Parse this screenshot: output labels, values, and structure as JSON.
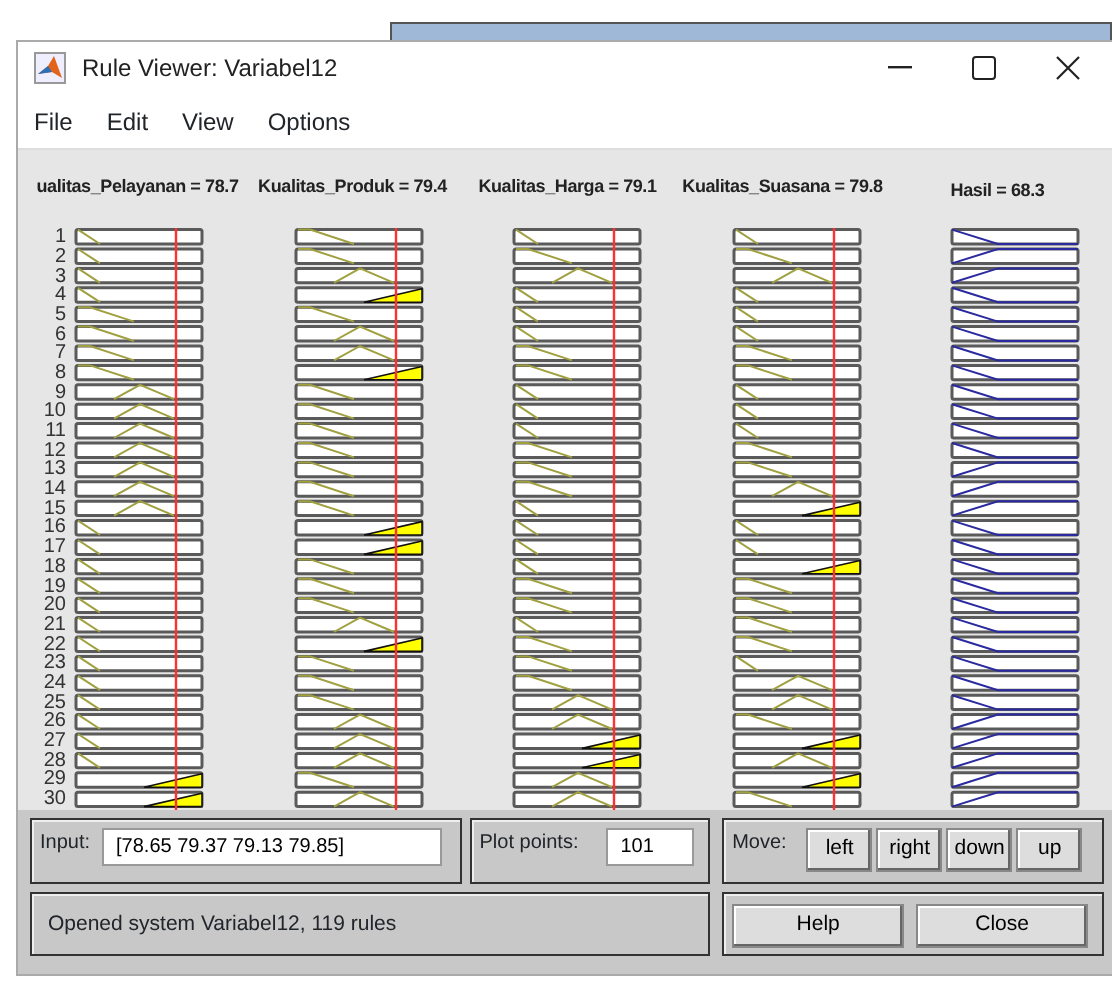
{
  "window": {
    "title": "Rule Viewer: Variabel12"
  },
  "menu": [
    "File",
    "Edit",
    "View",
    "Options"
  ],
  "rule_numbers": [
    "1",
    "2",
    "3",
    "4",
    "5",
    "6",
    "7",
    "8",
    "9",
    "10",
    "11",
    "12",
    "13",
    "14",
    "15",
    "16",
    "17",
    "18",
    "19",
    "20",
    "21",
    "22",
    "23",
    "24",
    "25",
    "26",
    "27",
    "28",
    "29",
    "30"
  ],
  "inputs": [
    {
      "heading": "ualitas_Pelayanan = 78.7",
      "cells": [
        {
          "kind": "low"
        },
        {
          "kind": "low"
        },
        {
          "kind": "low"
        },
        {
          "kind": "low"
        },
        {
          "kind": "fall"
        },
        {
          "kind": "fall"
        },
        {
          "kind": "fall"
        },
        {
          "kind": "fall"
        },
        {
          "kind": "mid"
        },
        {
          "kind": "mid"
        },
        {
          "kind": "mid"
        },
        {
          "kind": "mid"
        },
        {
          "kind": "mid"
        },
        {
          "kind": "mid"
        },
        {
          "kind": "mid"
        },
        {
          "kind": "low"
        },
        {
          "kind": "low"
        },
        {
          "kind": "low"
        },
        {
          "kind": "low"
        },
        {
          "kind": "low"
        },
        {
          "kind": "low"
        },
        {
          "kind": "low"
        },
        {
          "kind": "low"
        },
        {
          "kind": "low"
        },
        {
          "kind": "low"
        },
        {
          "kind": "low"
        },
        {
          "kind": "low"
        },
        {
          "kind": "low"
        },
        {
          "kind": "fired"
        },
        {
          "kind": "fired"
        }
      ]
    },
    {
      "heading": "Kualitas_Produk = 79.4",
      "cells": [
        {
          "kind": "fall"
        },
        {
          "kind": "fall"
        },
        {
          "kind": "mid"
        },
        {
          "kind": "fired"
        },
        {
          "kind": "fall"
        },
        {
          "kind": "mid"
        },
        {
          "kind": "mid"
        },
        {
          "kind": "fired"
        },
        {
          "kind": "fall"
        },
        {
          "kind": "fall"
        },
        {
          "kind": "fall"
        },
        {
          "kind": "fall"
        },
        {
          "kind": "fall"
        },
        {
          "kind": "fall"
        },
        {
          "kind": "fall"
        },
        {
          "kind": "fired"
        },
        {
          "kind": "fired"
        },
        {
          "kind": "fall"
        },
        {
          "kind": "fall"
        },
        {
          "kind": "fall"
        },
        {
          "kind": "mid"
        },
        {
          "kind": "fired"
        },
        {
          "kind": "fall"
        },
        {
          "kind": "fall"
        },
        {
          "kind": "fall"
        },
        {
          "kind": "mid"
        },
        {
          "kind": "mid"
        },
        {
          "kind": "mid"
        },
        {
          "kind": "fall"
        },
        {
          "kind": "mid"
        }
      ]
    },
    {
      "heading": "Kualitas_Harga = 79.1",
      "cells": [
        {
          "kind": "low"
        },
        {
          "kind": "fall"
        },
        {
          "kind": "mid"
        },
        {
          "kind": "low"
        },
        {
          "kind": "low"
        },
        {
          "kind": "low"
        },
        {
          "kind": "fall"
        },
        {
          "kind": "fall"
        },
        {
          "kind": "low"
        },
        {
          "kind": "low"
        },
        {
          "kind": "low"
        },
        {
          "kind": "fall"
        },
        {
          "kind": "fall"
        },
        {
          "kind": "fall"
        },
        {
          "kind": "low"
        },
        {
          "kind": "low"
        },
        {
          "kind": "low"
        },
        {
          "kind": "low"
        },
        {
          "kind": "fall"
        },
        {
          "kind": "fall"
        },
        {
          "kind": "low"
        },
        {
          "kind": "fall"
        },
        {
          "kind": "fall"
        },
        {
          "kind": "fall"
        },
        {
          "kind": "mid"
        },
        {
          "kind": "mid"
        },
        {
          "kind": "fired"
        },
        {
          "kind": "fired"
        },
        {
          "kind": "mid"
        },
        {
          "kind": "mid"
        }
      ]
    },
    {
      "heading": "Kualitas_Suasana = 79.8",
      "cells": [
        {
          "kind": "low"
        },
        {
          "kind": "fall"
        },
        {
          "kind": "mid"
        },
        {
          "kind": "low"
        },
        {
          "kind": "low"
        },
        {
          "kind": "low"
        },
        {
          "kind": "fall"
        },
        {
          "kind": "fall"
        },
        {
          "kind": "low"
        },
        {
          "kind": "low"
        },
        {
          "kind": "low"
        },
        {
          "kind": "fall"
        },
        {
          "kind": "fall"
        },
        {
          "kind": "mid"
        },
        {
          "kind": "fired"
        },
        {
          "kind": "low"
        },
        {
          "kind": "low"
        },
        {
          "kind": "fired"
        },
        {
          "kind": "fall"
        },
        {
          "kind": "fall"
        },
        {
          "kind": "fall"
        },
        {
          "kind": "fall"
        },
        {
          "kind": "low"
        },
        {
          "kind": "mid"
        },
        {
          "kind": "mid"
        },
        {
          "kind": "fall"
        },
        {
          "kind": "fired"
        },
        {
          "kind": "mid"
        },
        {
          "kind": "fired"
        },
        {
          "kind": "fall"
        }
      ]
    }
  ],
  "output": {
    "heading": "Hasil = 68.3",
    "cells": [
      {
        "kind": "fall"
      },
      {
        "kind": "rise"
      },
      {
        "kind": "rise"
      },
      {
        "kind": "fall"
      },
      {
        "kind": "fall"
      },
      {
        "kind": "fall"
      },
      {
        "kind": "fall"
      },
      {
        "kind": "fall"
      },
      {
        "kind": "fall"
      },
      {
        "kind": "fall"
      },
      {
        "kind": "fall"
      },
      {
        "kind": "fall"
      },
      {
        "kind": "rise"
      },
      {
        "kind": "rise"
      },
      {
        "kind": "rise"
      },
      {
        "kind": "fall"
      },
      {
        "kind": "fall"
      },
      {
        "kind": "fall"
      },
      {
        "kind": "fall"
      },
      {
        "kind": "fall"
      },
      {
        "kind": "fall"
      },
      {
        "kind": "fall"
      },
      {
        "kind": "fall"
      },
      {
        "kind": "fall"
      },
      {
        "kind": "fall"
      },
      {
        "kind": "rise"
      },
      {
        "kind": "rise"
      },
      {
        "kind": "rise"
      },
      {
        "kind": "rise"
      },
      {
        "kind": "rise"
      }
    ]
  },
  "input_field": {
    "label": "Input:",
    "value": "[78.65 79.37 79.13 79.85]"
  },
  "plot_points": {
    "label": "Plot points:",
    "value": "101"
  },
  "move": {
    "label": "Move:",
    "buttons": [
      "left",
      "right",
      "down",
      "up"
    ]
  },
  "status": "Opened system Variabel12, 119 rules",
  "buttons": [
    "Help",
    "Close"
  ]
}
